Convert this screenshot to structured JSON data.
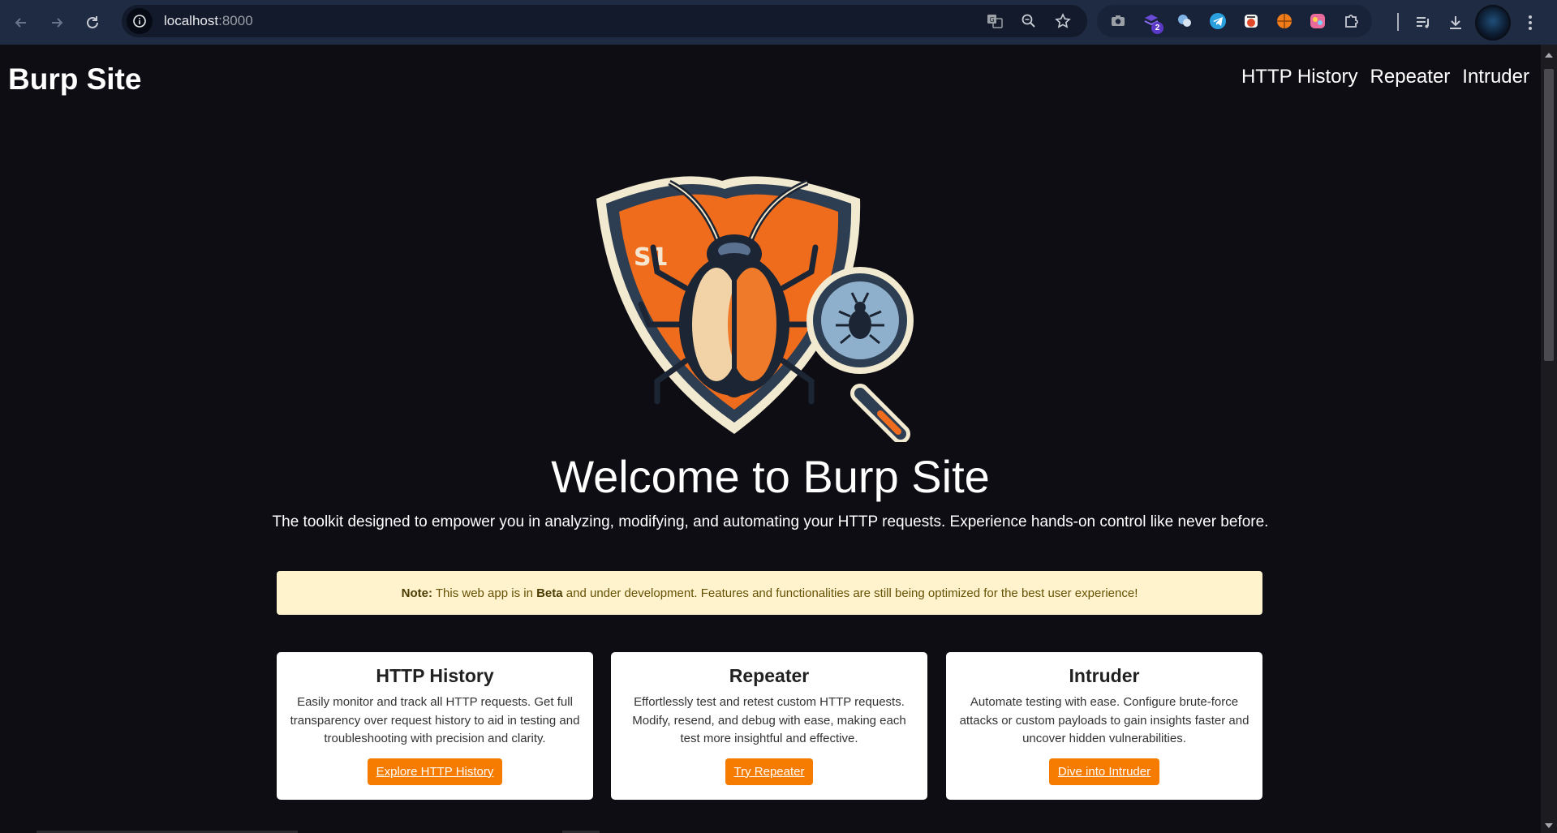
{
  "browser": {
    "url_host": "localhost",
    "url_port": ":8000",
    "extensions": [
      {
        "name": "camera-ext-icon",
        "color": "#9aa0a6"
      },
      {
        "name": "layers-ext-icon",
        "color": "#6a4bd6",
        "badge": "2"
      },
      {
        "name": "translate-ext-icon",
        "color": "#7fb3e6"
      },
      {
        "name": "telegram-ext-icon",
        "color": "#2aa1de"
      },
      {
        "name": "chef-ext-icon",
        "color": "#e04a2b"
      },
      {
        "name": "basketball-ext-icon",
        "color": "#f07d1a"
      },
      {
        "name": "colorful-ext-icon",
        "color": "#e86b9b"
      }
    ]
  },
  "site": {
    "brand": "Burp Site",
    "nav": [
      "HTTP History",
      "Repeater",
      "Intruder"
    ],
    "hero_title": "Welcome to Burp Site",
    "tagline": "The toolkit designed to empower you in analyzing, modifying, and automating your HTTP requests. Experience hands-on control like never before.",
    "note": {
      "label": "Note:",
      "text_before": " This web app is in ",
      "emph": "Beta",
      "text_after": " and under development. Features and functionalities are still being optimized for the best user experience!"
    },
    "cards": [
      {
        "title": "HTTP History",
        "body": "Easily monitor and track all HTTP requests. Get full transparency over request history to aid in testing and troubleshooting with precision and clarity.",
        "button": "Explore HTTP History"
      },
      {
        "title": "Repeater",
        "body": "Effortlessly test and retest custom HTTP requests. Modify, resend, and debug with ease, making each test more insightful and effective.",
        "button": "Try Repeater"
      },
      {
        "title": "Intruder",
        "body": "Automate testing with ease. Configure brute-force attacks or custom payloads to gain insights faster and uncover hidden vulnerabilities.",
        "button": "Dive into Intruder"
      }
    ],
    "colors": {
      "background": "#0e0d14",
      "accent": "#f57c00",
      "note_bg": "#fff3cd"
    }
  }
}
